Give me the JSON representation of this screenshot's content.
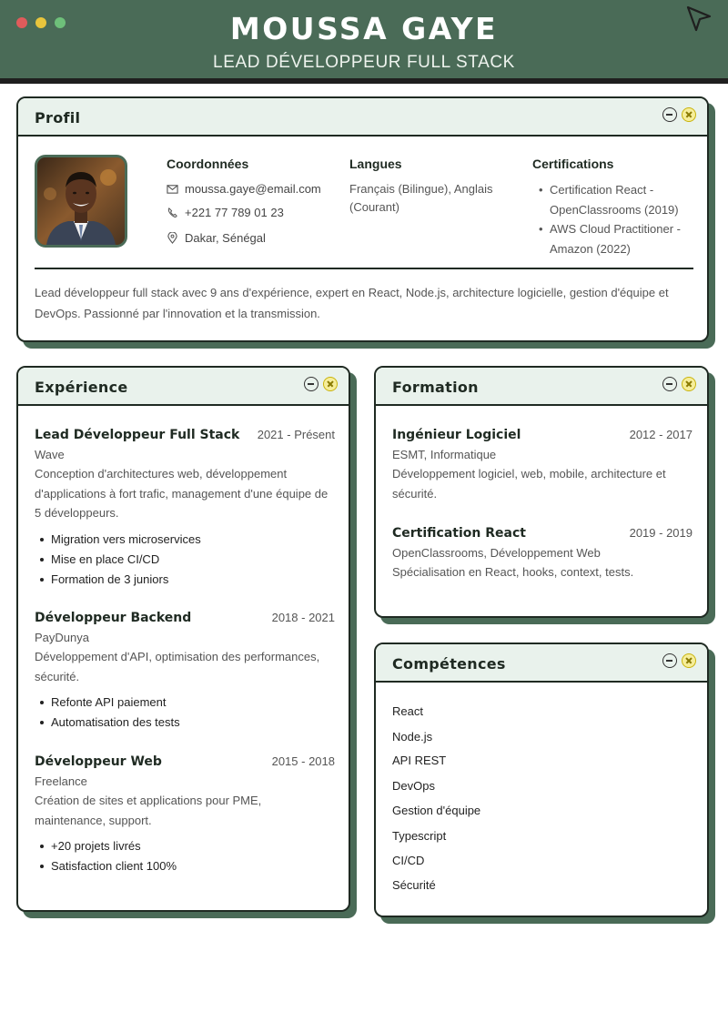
{
  "header": {
    "name": "MOUSSA GAYE",
    "role": "LEAD DÉVELOPPEUR FULL STACK"
  },
  "profil": {
    "title": "Profil",
    "contact_title": "Coordonnées",
    "email": "moussa.gaye@email.com",
    "phone": "+221 77 789 01 23",
    "location": "Dakar, Sénégal",
    "languages_title": "Langues",
    "languages": "Français (Bilingue), Anglais (Courant)",
    "certifications_title": "Certifications",
    "certifications": [
      "Certification React - OpenClassrooms (2019)",
      "AWS Cloud Practitioner - Amazon (2022)"
    ],
    "summary": "Lead développeur full stack avec 9 ans d'expérience, expert en React, Node.js, architecture logicielle, gestion d'équipe et DevOps. Passionné par l'innovation et la transmission."
  },
  "experience": {
    "title": "Expérience",
    "items": [
      {
        "title": "Lead Développeur Full Stack",
        "date": "2021 - Présent",
        "org": "Wave",
        "desc": "Conception d'architectures web, développement d'applications à fort trafic, management d'une équipe de 5 développeurs.",
        "bullets": [
          "Migration vers microservices",
          "Mise en place CI/CD",
          "Formation de 3 juniors"
        ]
      },
      {
        "title": "Développeur Backend",
        "date": "2018 - 2021",
        "org": "PayDunya",
        "desc": "Développement d'API, optimisation des performances, sécurité.",
        "bullets": [
          "Refonte API paiement",
          "Automatisation des tests"
        ]
      },
      {
        "title": "Développeur Web",
        "date": "2015 - 2018",
        "org": "Freelance",
        "desc": "Création de sites et applications pour PME, maintenance, support.",
        "bullets": [
          "+20 projets livrés",
          "Satisfaction client 100%"
        ]
      }
    ]
  },
  "formation": {
    "title": "Formation",
    "items": [
      {
        "title": "Ingénieur Logiciel",
        "date": "2012 - 2017",
        "org": "ESMT, Informatique",
        "desc": "Développement logiciel, web, mobile, architecture et sécurité."
      },
      {
        "title": "Certification React",
        "date": "2019 - 2019",
        "org": "OpenClassrooms, Développement Web",
        "desc": "Spécialisation en React, hooks, context, tests."
      }
    ]
  },
  "competences": {
    "title": "Compétences",
    "items": [
      "React",
      "Node.js",
      "API REST",
      "DevOps",
      "Gestion d'équipe",
      "Typescript",
      "CI/CD",
      "Sécurité"
    ]
  },
  "colors": {
    "header": "#4a6b57",
    "card_head": "#e9f2ec",
    "border": "#1f2a22",
    "shadow": "#4a6b57"
  }
}
